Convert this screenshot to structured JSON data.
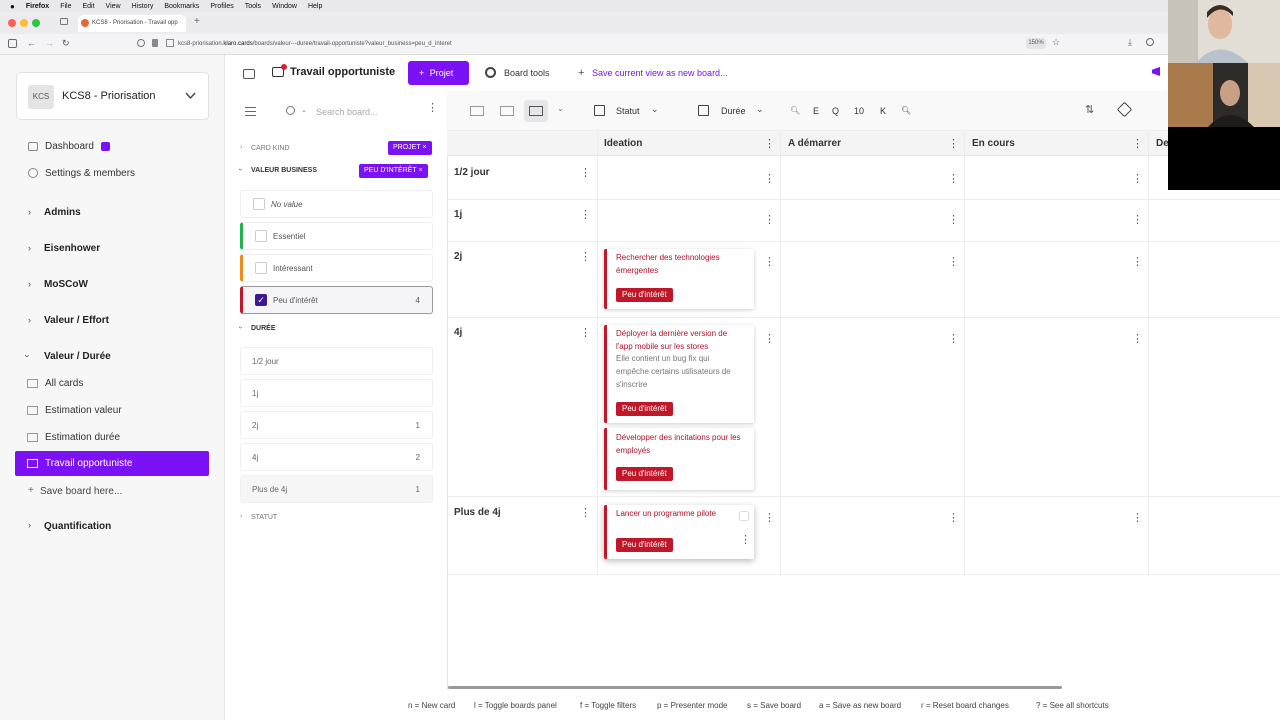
{
  "mac_menu": [
    "Firefox",
    "File",
    "Edit",
    "View",
    "History",
    "Bookmarks",
    "Profiles",
    "Tools",
    "Window",
    "Help"
  ],
  "browser": {
    "tab_title": "KCS8 - Priorisation - Travail opp",
    "url_prefix": "kcs8-priorisation.",
    "url_host": "klaro.cards",
    "url_path": "/boards/valeur---duree/travail-opportuniste?valeur_business=peu_d_interet",
    "zoom": "150%"
  },
  "sidebar": {
    "workspace_logo": "KCS",
    "workspace_name": "KCS8 - Priorisation",
    "dashboard": "Dashboard",
    "settings": "Settings & members",
    "groups": [
      "Admins",
      "Eisenhower",
      "MoSCoW",
      "Valeur / Effort",
      "Valeur / Durée"
    ],
    "boards": [
      "All cards",
      "Estimation valeur",
      "Estimation durée",
      "Travail opportuniste"
    ],
    "save_board": "Save board here...",
    "quantification": "Quantification"
  },
  "header": {
    "title": "Travail opportuniste",
    "projet_button": "Projet",
    "board_tools": "Board tools",
    "save_view": "Save current view as new board..."
  },
  "filters": {
    "search_placeholder": "Search board...",
    "card_kind": "CARD KIND",
    "card_kind_chip": "PROJET",
    "valeur_business": "VALEUR BUSINESS",
    "valeur_chip": "PEU D'INTÉRÊT",
    "valeur_options": [
      {
        "label": "No value",
        "count": "",
        "color": "",
        "checked": false
      },
      {
        "label": "Essentiel",
        "count": "",
        "color": "#22b14c",
        "checked": false
      },
      {
        "label": "Intéressant",
        "count": "",
        "color": "#f08a1c",
        "checked": false
      },
      {
        "label": "Peu d'intérêt",
        "count": "4",
        "color": "#c0182a",
        "checked": true
      }
    ],
    "duree": "DURÉE",
    "duree_options": [
      {
        "label": "1/2 jour",
        "count": ""
      },
      {
        "label": "1j",
        "count": ""
      },
      {
        "label": "2j",
        "count": "1"
      },
      {
        "label": "4j",
        "count": "2"
      },
      {
        "label": "Plus de 4j",
        "count": "1"
      }
    ],
    "statut": "STATUT"
  },
  "toolbar": {
    "statut": "Statut",
    "duree": "Durée",
    "letters": [
      "E",
      "Q",
      "10",
      "K"
    ]
  },
  "columns": [
    "Ideation",
    "A démarrer",
    "En cours",
    "De"
  ],
  "rows": [
    "1/2 jour",
    "1j",
    "2j",
    "4j",
    "Plus de 4j"
  ],
  "cards": [
    {
      "title": "Rechercher des technologies émergentes",
      "desc": "",
      "tag": "Peu d'intérêt"
    },
    {
      "title": "Déployer la dernière version de l'app mobile sur les stores",
      "desc": "Elle contient un bug fix qui empêche certains utilisateurs de s'inscrire",
      "tag": "Peu d'intérêt"
    },
    {
      "title": "Développer des incitations pour les employés",
      "desc": "",
      "tag": "Peu d'intérêt"
    },
    {
      "title": "Lancer un programme pilote",
      "desc": "",
      "tag": "Peu d'intérêt"
    }
  ],
  "shortcuts": [
    "n = New card",
    "l = Toggle boards panel",
    "f = Toggle filters",
    "p = Presenter mode",
    "s = Save board",
    "a = Save as new board",
    "r = Reset board changes",
    "? = See all shortcuts"
  ],
  "colors": {
    "accent": "#7b12f5",
    "tag": "#c0182a"
  }
}
